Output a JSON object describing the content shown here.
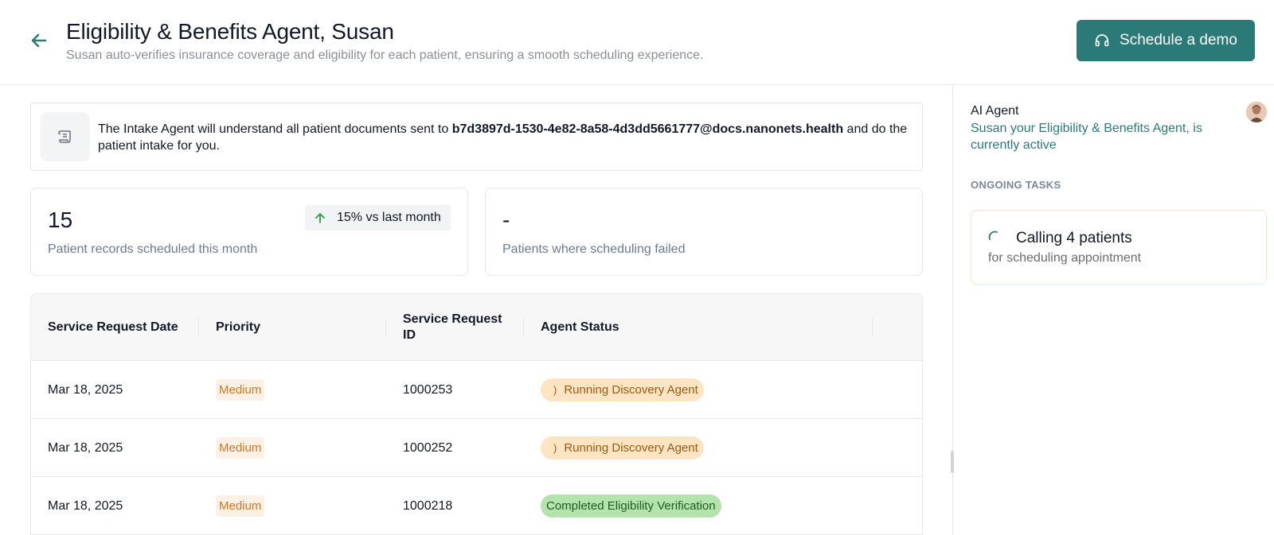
{
  "header": {
    "title": "Eligibility & Benefits Agent, Susan",
    "subtitle": "Susan auto-verifies insurance coverage and eligibility for each patient, ensuring a smooth scheduling experience.",
    "demo_button_label": "Schedule a demo",
    "icons": {
      "back": "arrow-left-icon",
      "demo": "headset-icon"
    }
  },
  "info": {
    "icon": "scroll-icon",
    "text_before": "The Intake Agent will understand all patient documents sent to ",
    "email": "b7d3897d-1530-4e82-8a58-4d3dd5661777@docs.nanonets.health",
    "text_after": " and do the patient intake for you."
  },
  "stats": [
    {
      "value": "15",
      "label": "Patient records scheduled this month",
      "trend": "15% vs last month",
      "trend_icon": "arrow-up-icon"
    },
    {
      "value": "-",
      "label": "Patients where scheduling failed"
    }
  ],
  "table": {
    "columns": [
      "Service Request Date",
      "Priority",
      "Service Request ID",
      "Agent Status"
    ],
    "rows": [
      {
        "date": "Mar 18, 2025",
        "priority": "Medium",
        "id": "1000253",
        "status": "Running Discovery Agent",
        "status_type": "running"
      },
      {
        "date": "Mar 18, 2025",
        "priority": "Medium",
        "id": "1000252",
        "status": "Running Discovery Agent",
        "status_type": "running"
      },
      {
        "date": "Mar 18, 2025",
        "priority": "Medium",
        "id": "1000218",
        "status": "Completed Eligibility Verification",
        "status_type": "completed"
      }
    ]
  },
  "sidebar": {
    "agent_label": "AI Agent",
    "agent_status": "Susan your Eligibility & Benefits Agent, is currently active",
    "section_title": "ONGOING TASKS",
    "task": {
      "title": "Calling 4 patients",
      "subtitle": "for scheduling appointment"
    }
  },
  "colors": {
    "accent": "#2b7a78",
    "priority_bg": "#fdf1e6",
    "priority_text": "#d4761f",
    "running_bg": "#fde4c2",
    "completed_bg": "#b5e3ae"
  }
}
